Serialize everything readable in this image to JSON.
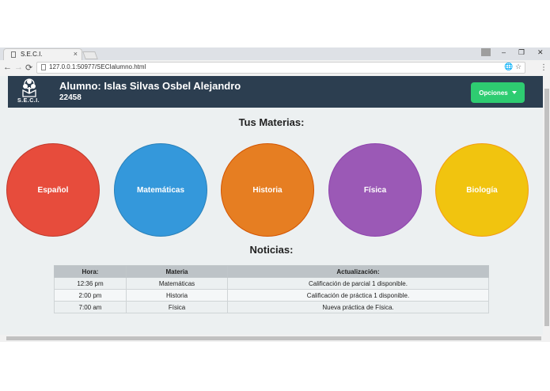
{
  "browser": {
    "tab_title": "S.E.C.I.",
    "tab_close": "×",
    "url": "127.0.0.1:50977/SECIalumno.html",
    "nav": {
      "back": "←",
      "forward": "→",
      "reload": "⟳"
    },
    "window": {
      "minimize": "–",
      "restore": "❐",
      "close": "✕"
    },
    "menu": "⋮",
    "ext_icon": "🌐",
    "bookmark": "☆"
  },
  "header": {
    "logo_text": "S.E.C.I.",
    "student_name": "Alumno: Islas Silvas Osbel Alejandro",
    "student_id": "22458",
    "options_label": "Opciones"
  },
  "subjects": {
    "title": "Tus Materias:",
    "items": [
      {
        "label": "Español",
        "color": "#e74c3c"
      },
      {
        "label": "Matemáticas",
        "color": "#3498db"
      },
      {
        "label": "Historia",
        "color": "#e67e22"
      },
      {
        "label": "Física",
        "color": "#9b59b6"
      },
      {
        "label": "Biología",
        "color": "#f1c40f"
      }
    ]
  },
  "news": {
    "title": "Noticias:",
    "headers": [
      "Hora:",
      "Materia",
      "Actualización:"
    ],
    "rows": [
      [
        "12:36 pm",
        "Matemáticas",
        "Calificación de parcial 1 disponible."
      ],
      [
        "2:00 pm",
        "Historia",
        "Calificación de práctica 1 disponible."
      ],
      [
        "7:00 am",
        "Física",
        "Nueva práctica de Física."
      ]
    ]
  },
  "colors": {
    "navbar": "#2c3e50",
    "background": "#ecf0f1",
    "options_button": "#2ecc71"
  }
}
